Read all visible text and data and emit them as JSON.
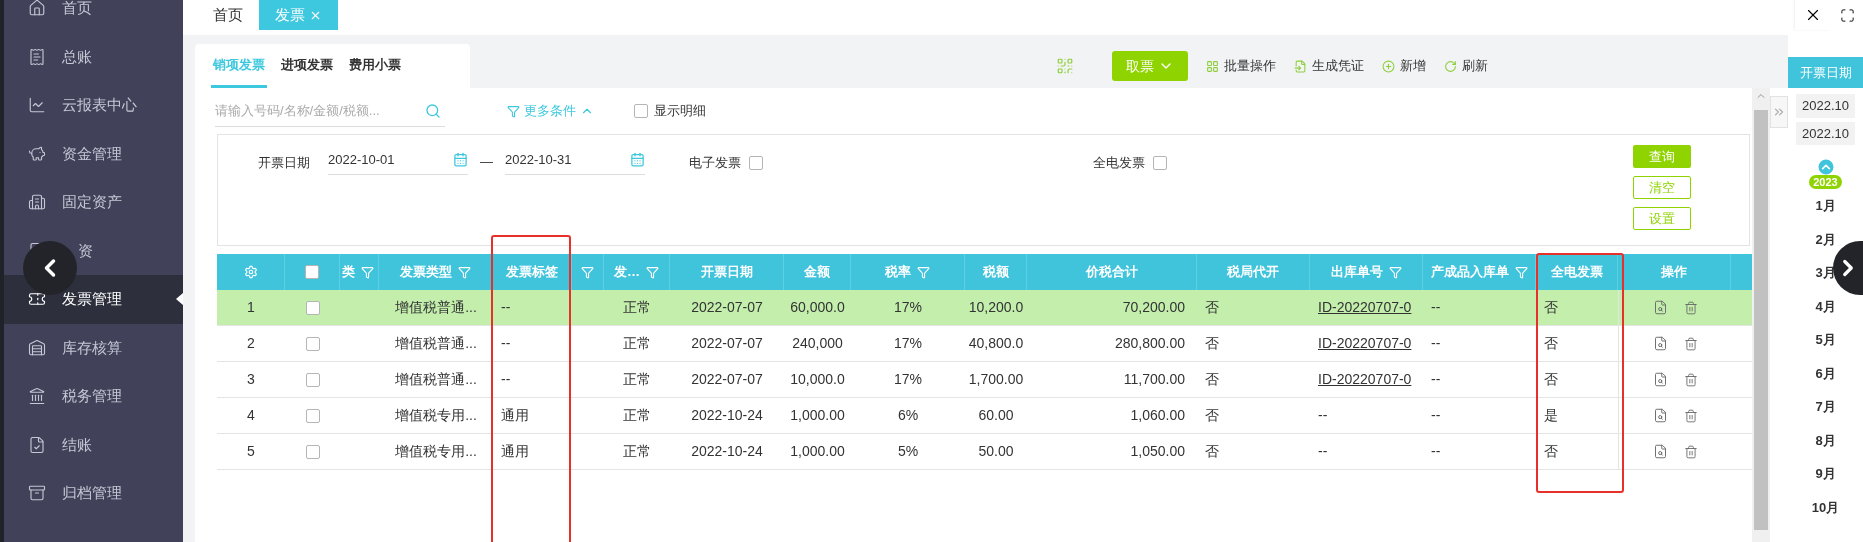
{
  "sidebar": {
    "items": [
      {
        "label": "首页",
        "kind": "home",
        "selected": false
      },
      {
        "label": "总账",
        "kind": "ledger",
        "selected": false
      },
      {
        "label": "云报表中心",
        "kind": "report",
        "selected": false
      },
      {
        "label": "资金管理",
        "kind": "fund",
        "selected": false
      },
      {
        "label": "固定资产",
        "kind": "asset",
        "selected": false
      },
      {
        "label": "资",
        "kind": "salary",
        "selected": false
      },
      {
        "label": "发票管理",
        "kind": "invoice",
        "selected": true
      },
      {
        "label": "库存核算",
        "kind": "stock",
        "selected": false
      },
      {
        "label": "税务管理",
        "kind": "tax",
        "selected": false
      },
      {
        "label": "结账",
        "kind": "close",
        "selected": false
      },
      {
        "label": "归档管理",
        "kind": "archive",
        "selected": false
      }
    ]
  },
  "page_tabs": [
    {
      "label": "首页",
      "selected": false,
      "closable": false
    },
    {
      "label": "发票",
      "selected": true,
      "closable": true
    }
  ],
  "sub_tabs": [
    {
      "label": "销项发票",
      "selected": true
    },
    {
      "label": "进项发票",
      "selected": false
    },
    {
      "label": "费用小票",
      "selected": false
    }
  ],
  "toolbar": {
    "primary": "取票",
    "actions": [
      {
        "label": "批量操作",
        "kind": "batch"
      },
      {
        "label": "生成凭证",
        "kind": "voucher"
      },
      {
        "label": "新增",
        "kind": "add"
      },
      {
        "label": "刷新",
        "kind": "refresh"
      }
    ]
  },
  "search": {
    "placeholder": "请输入号码/名称/金额/税额..."
  },
  "more_conditions": {
    "label": "更多条件",
    "expanded": true
  },
  "show_detail": {
    "label": "显示明细",
    "checked": false
  },
  "filter": {
    "date_label": "开票日期",
    "start": "2022-10-01",
    "separator": "—",
    "end": "2022-10-31",
    "checks": [
      {
        "label": "电子发票",
        "checked": false
      },
      {
        "label": "全电发票",
        "checked": false
      }
    ],
    "buttons": [
      {
        "label": "查询",
        "kind": "primary"
      },
      {
        "label": "清空",
        "kind": "outline"
      },
      {
        "label": "设置",
        "kind": "outline"
      }
    ]
  },
  "table": {
    "all_checked": false,
    "columns": [
      {
        "label": "类",
        "filter": true
      },
      {
        "label": "发票类型",
        "filter": true
      },
      {
        "label": "发票标签",
        "filter": false
      },
      {
        "filter": true
      },
      {
        "label": "发…",
        "filter": true
      },
      {
        "label": "开票日期",
        "filter": false
      },
      {
        "label": "金额",
        "filter": false
      },
      {
        "label": "税率",
        "filter": true
      },
      {
        "label": "税额",
        "filter": false
      },
      {
        "label": "价税合计",
        "filter": false
      },
      {
        "label": "税局代开",
        "filter": false
      },
      {
        "label": "出库单号",
        "filter": true
      },
      {
        "label": "产成品入库单",
        "filter": true
      },
      {
        "label": "全电发票",
        "filter": false
      },
      {
        "label": "操作",
        "filter": false
      }
    ],
    "rows": [
      {
        "no": "1",
        "checked": false,
        "selected": true,
        "cells": [
          null,
          "增值税普通...",
          "--",
          null,
          "正常",
          "2022-07-07",
          "60,000.0",
          "17%",
          "10,200.0",
          "70,200.00",
          "否",
          "ID-20220707-0",
          "--",
          "否"
        ]
      },
      {
        "no": "2",
        "checked": false,
        "selected": false,
        "cells": [
          null,
          "增值税普通...",
          "--",
          null,
          "正常",
          "2022-07-07",
          "240,000",
          "17%",
          "40,800.0",
          "280,800.00",
          "否",
          "ID-20220707-0",
          "--",
          "否"
        ]
      },
      {
        "no": "3",
        "checked": false,
        "selected": false,
        "cells": [
          null,
          "增值税普通...",
          "--",
          null,
          "正常",
          "2022-07-07",
          "10,000.0",
          "17%",
          "1,700.00",
          "11,700.00",
          "否",
          "ID-20220707-0",
          "--",
          "否"
        ]
      },
      {
        "no": "4",
        "checked": false,
        "selected": false,
        "cells": [
          null,
          "增值税专用...",
          "通用",
          null,
          "正常",
          "2022-10-24",
          "1,000.00",
          "6%",
          "60.00",
          "1,060.00",
          "否",
          "--",
          "--",
          "是"
        ]
      },
      {
        "no": "5",
        "checked": false,
        "selected": false,
        "cells": [
          null,
          "增值税专用...",
          "通用",
          null,
          "正常",
          "2022-10-24",
          "1,000.00",
          "5%",
          "50.00",
          "1,050.00",
          "否",
          "--",
          "--",
          "否"
        ]
      }
    ]
  },
  "date_panel": {
    "title": "开票日期",
    "periods": [
      "2022.10",
      "2022.10"
    ],
    "year": "2023",
    "months": [
      "1月",
      "2月",
      "3月",
      "4月",
      "5月",
      "6月",
      "7月",
      "8月",
      "9月",
      "10月"
    ]
  }
}
